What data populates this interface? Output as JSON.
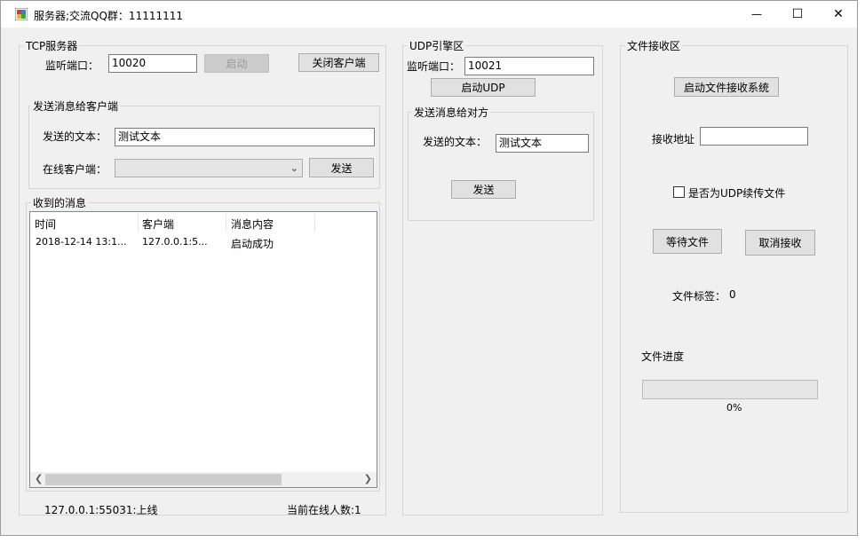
{
  "window": {
    "title": "服务器;交流QQ群：11111111",
    "minimize_glyph": "—",
    "maximize_glyph": "☐",
    "close_glyph": "✕"
  },
  "tcp": {
    "group_title": "TCP服务器",
    "port_label": "监听端口：",
    "port_value": "10020",
    "start_button": "启动",
    "close_client_button": "关闭客户端",
    "send_group_title": "发送消息给客户端",
    "send_text_label": "发送的文本：",
    "send_text_value": "测试文本",
    "online_client_label": "在线客户端：",
    "online_client_value": "",
    "send_button": "发送",
    "received_group_title": "收到的消息",
    "columns": [
      "时间",
      "客户端",
      "消息内容"
    ],
    "rows": [
      {
        "time": "2018-12-14 13:1...",
        "client": "127.0.0.1:5...",
        "message": "启动成功"
      }
    ],
    "status_left": "127.0.0.1:55031:上线",
    "status_right": "当前在线人数:1"
  },
  "udp": {
    "group_title": "UDP引擎区",
    "port_label": "监听端口：",
    "port_value": "10021",
    "start_button": "启动UDP",
    "send_group_title": "发送消息给对方",
    "send_text_label": "发送的文本：",
    "send_text_value": "测试文本",
    "send_button": "发送"
  },
  "file": {
    "group_title": "文件接收区",
    "start_button": "启动文件接收系统",
    "address_label": "接收地址",
    "address_value": "",
    "resume_label": "是否为UDP续传文件",
    "resume_checked": false,
    "wait_button": "等待文件",
    "cancel_button": "取消接收",
    "tag_label": "文件标签：",
    "tag_value": "0",
    "progress_label": "文件进度",
    "progress_text": "0%",
    "progress_fraction": 0
  },
  "colors": {
    "window_bg": "#f0f0f0",
    "progress_green": "#06b025",
    "background_accent": "#3ca63c"
  }
}
